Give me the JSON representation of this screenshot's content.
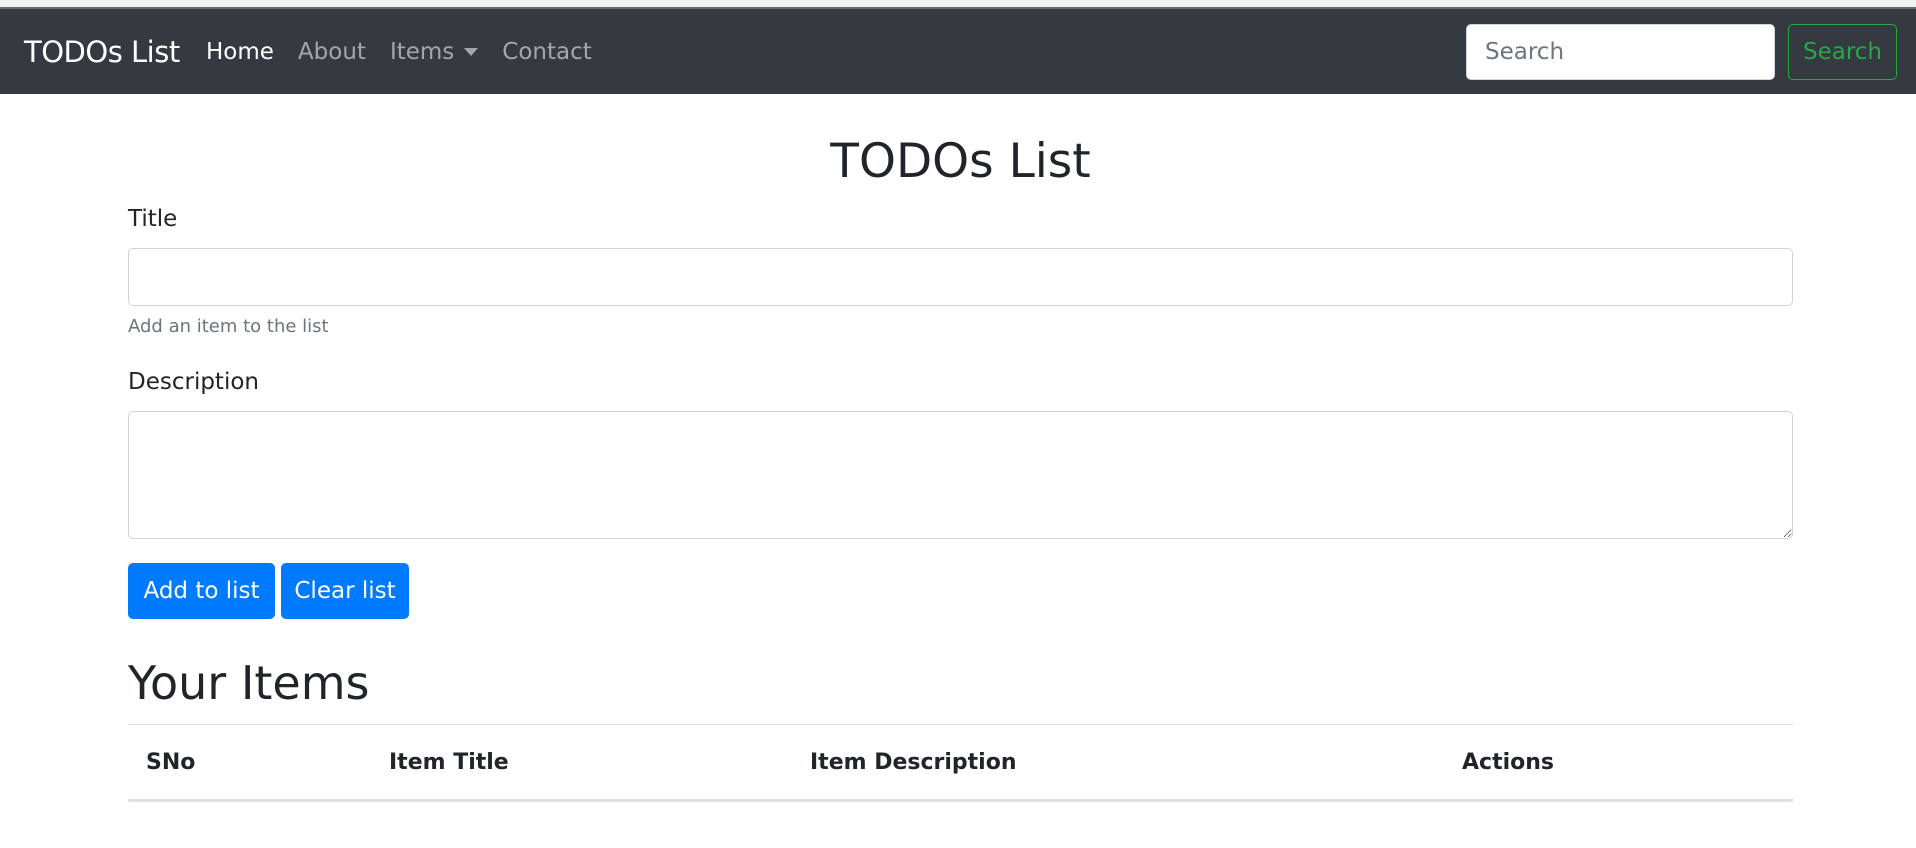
{
  "navbar": {
    "brand": "TODOs List",
    "links": [
      {
        "label": "Home"
      },
      {
        "label": "About"
      },
      {
        "label": "Items"
      },
      {
        "label": "Contact"
      }
    ],
    "search": {
      "placeholder": "Search",
      "button_label": "Search"
    }
  },
  "main": {
    "title": "TODOs List",
    "form": {
      "title_label": "Title",
      "title_value": "",
      "title_help": "Add an item to the list",
      "description_label": "Description",
      "description_value": "",
      "add_button": "Add to list",
      "clear_button": "Clear list"
    },
    "items_heading": "Your Items",
    "table": {
      "columns": [
        "SNo",
        "Item Title",
        "Item Description",
        "Actions"
      ]
    }
  },
  "colors": {
    "navbar_bg": "#343a40",
    "primary": "#007bff",
    "success": "#28a745"
  }
}
